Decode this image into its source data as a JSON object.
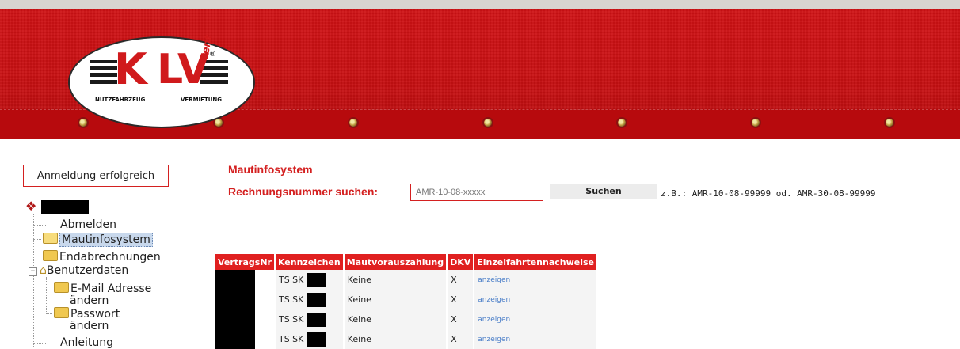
{
  "colors": {
    "accent": "#d42020",
    "banner": "#c80f12",
    "link": "#4a7ec8"
  },
  "logo": {
    "left": "K",
    "right": "LV",
    "script": "rent",
    "reg": "®",
    "tag_left": "NUTZFAHRZEUG",
    "tag_right": "VERMIETUNG"
  },
  "sidebar": {
    "status": "Anmeldung erfolgreich",
    "items": [
      {
        "label": "Abmelden",
        "icon": ""
      },
      {
        "label": "Mautinfosystem",
        "icon": "folder-icon"
      },
      {
        "label": "Endabrechnungen",
        "icon": "folder-icon"
      },
      {
        "label": "Benutzerdaten",
        "icon": "house-folder-icon"
      },
      {
        "label": "E-Mail Adresse",
        "label2": "ändern",
        "icon": "folder-icon"
      },
      {
        "label": "Passwort",
        "label2": "ändern",
        "icon": "folder-icon"
      },
      {
        "label": "Anleitung",
        "icon": ""
      }
    ],
    "expander": "−"
  },
  "main": {
    "title": "Mautinfosystem",
    "search_label": "Rechnungsnummer suchen:",
    "search_placeholder": "AMR-10-08-xxxxx",
    "search_button": "Suchen",
    "example": "z.B.: AMR-10-08-99999 od. AMR-30-08-99999"
  },
  "table": {
    "headers": [
      "VertragsNr",
      "Kennzeichen",
      "Mautvorauszahlung",
      "DKV",
      "Einzelfahrtennachweise"
    ],
    "rows": [
      {
        "kennzeichen": "TS SK",
        "maut": "Keine",
        "dkv": "X",
        "link": "anzeigen"
      },
      {
        "kennzeichen": "TS SK",
        "maut": "Keine",
        "dkv": "X",
        "link": "anzeigen"
      },
      {
        "kennzeichen": "TS SK",
        "maut": "Keine",
        "dkv": "X",
        "link": "anzeigen"
      },
      {
        "kennzeichen": "TS SK",
        "maut": "Keine",
        "dkv": "X",
        "link": "anzeigen"
      }
    ]
  }
}
